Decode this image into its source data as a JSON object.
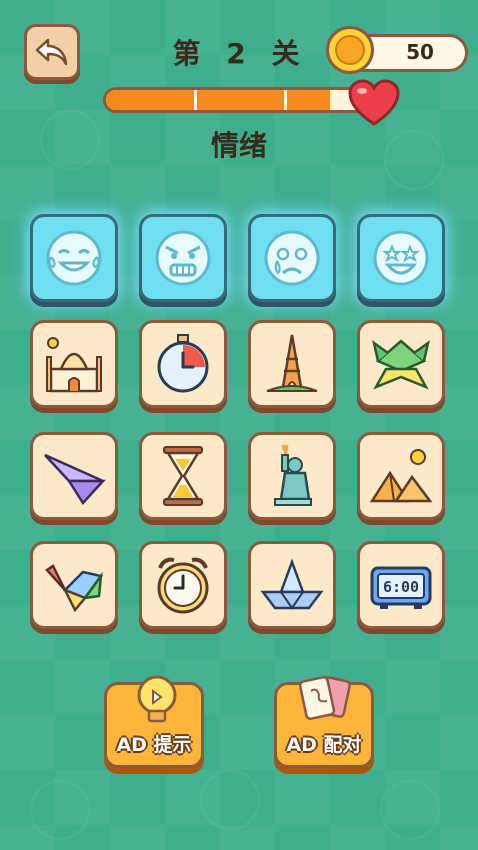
{
  "header": {
    "level_title": "第 2 关",
    "coins": "50",
    "progress": 0.85,
    "category": "情绪"
  },
  "rows": [
    [
      {
        "icon": "crying-laughing-face-icon",
        "glow": true
      },
      {
        "icon": "angry-face-icon",
        "glow": true
      },
      {
        "icon": "crying-face-icon",
        "glow": true
      },
      {
        "icon": "star-eyes-face-icon",
        "glow": true
      }
    ],
    [
      {
        "icon": "taj-mahal-icon",
        "glow": false
      },
      {
        "icon": "stopwatch-icon",
        "glow": false
      },
      {
        "icon": "eiffel-tower-icon",
        "glow": false
      },
      {
        "icon": "origami-frog-icon",
        "glow": false
      }
    ],
    [
      {
        "icon": "paper-plane-icon",
        "glow": false
      },
      {
        "icon": "hourglass-icon",
        "glow": false
      },
      {
        "icon": "statue-of-liberty-icon",
        "glow": false
      },
      {
        "icon": "pyramids-icon",
        "glow": false
      }
    ],
    [
      {
        "icon": "origami-crane-icon",
        "glow": false
      },
      {
        "icon": "alarm-clock-icon",
        "glow": false
      },
      {
        "icon": "paper-boat-icon",
        "glow": false
      },
      {
        "icon": "digital-clock-icon",
        "glow": false
      }
    ]
  ],
  "digital_clock_text": "6:00",
  "buttons": {
    "hint_label": "AD 提示",
    "match_label": "AD 配对"
  },
  "colors": {
    "background": "#3fae8f",
    "tile": "#fbe9c8",
    "tile_glow": "#6fe0f2",
    "progress": "#f38a1c",
    "button": "#ffb43a"
  }
}
